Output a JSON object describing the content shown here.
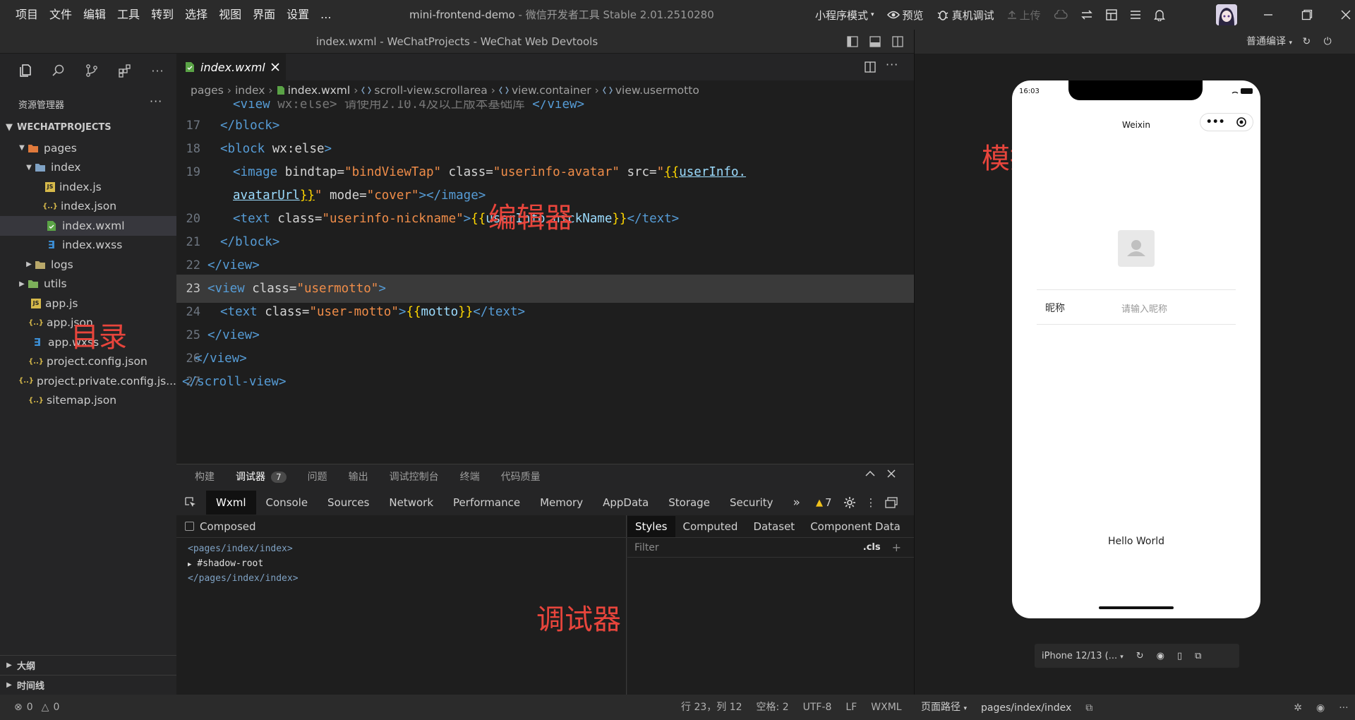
{
  "titlebar": {
    "menu": [
      "项目",
      "文件",
      "编辑",
      "工具",
      "转到",
      "选择",
      "视图",
      "界面",
      "设置",
      "..."
    ],
    "project_name": "mini-frontend-demo",
    "app_name": "微信开发者工具 Stable 2.01.2510280",
    "mode": "小程序模式",
    "preview": "预览",
    "real_debug": "真机调试",
    "upload": "上传"
  },
  "window_title": "index.wxml - WeChatProjects - WeChat Web Devtools",
  "explorer": {
    "title": "资源管理器",
    "more": "···",
    "project": "WECHATPROJECTS",
    "tree": [
      {
        "label": "pages",
        "type": "folder",
        "open": true
      },
      {
        "label": "index",
        "type": "folder",
        "open": true
      },
      {
        "label": "index.js",
        "type": "js"
      },
      {
        "label": "index.json",
        "type": "json"
      },
      {
        "label": "index.wxml",
        "type": "wxml",
        "selected": true
      },
      {
        "label": "index.wxss",
        "type": "wxss"
      },
      {
        "label": "logs",
        "type": "folder",
        "open": false
      },
      {
        "label": "utils",
        "type": "folder",
        "open": false
      },
      {
        "label": "app.js",
        "type": "js"
      },
      {
        "label": "app.json",
        "type": "json"
      },
      {
        "label": "app.wxss",
        "type": "wxss"
      },
      {
        "label": "project.config.json",
        "type": "json"
      },
      {
        "label": "project.private.config.js...",
        "type": "json"
      },
      {
        "label": "sitemap.json",
        "type": "json"
      }
    ],
    "outline": "大纲",
    "timeline": "时间线"
  },
  "editor": {
    "tab": "index.wxml",
    "breadcrumb": [
      "pages",
      "index",
      "index.wxml",
      "scroll-view.scrollarea",
      "view.container",
      "view.usermotto"
    ],
    "line_numbers": [
      "17",
      "18",
      "19",
      "",
      "20",
      "21",
      "22",
      "23",
      "24",
      "25",
      "26",
      "27"
    ],
    "current_line": "23"
  },
  "debugger": {
    "tabs": [
      "构建",
      "调试器",
      "问题",
      "输出",
      "调试控制台",
      "终端",
      "代码质量"
    ],
    "badge": "7",
    "devtools_tabs": [
      "Wxml",
      "Console",
      "Sources",
      "Network",
      "Performance",
      "Memory",
      "AppData",
      "Storage",
      "Security"
    ],
    "more": "»",
    "warnings": "7",
    "composed": "Composed",
    "dom": [
      "<pages/index/index>",
      "#shadow-root",
      "</pages/index/index>"
    ],
    "style_tabs": [
      "Styles",
      "Computed",
      "Dataset",
      "Component Data"
    ],
    "filter_placeholder": "Filter",
    "cls": ".cls",
    "plus": "+"
  },
  "annotations": {
    "explorer": "目录",
    "editor": "编辑器",
    "debugger": "调试器",
    "simulator": "模拟器"
  },
  "simulator": {
    "compile_mode": "普通编译",
    "clock": "16:03",
    "nav_title": "Weixin",
    "nickname_label": "昵称",
    "nickname_placeholder": "请输入昵称",
    "motto": "Hello World",
    "device": "iPhone 12/13 (..."
  },
  "statusbar": {
    "errors": "0",
    "warnings": "0",
    "position": "行 23，列 12",
    "spaces": "空格: 2",
    "encoding": "UTF-8",
    "eol": "LF",
    "language": "WXML",
    "page_path_label": "页面路径",
    "page_path": "pages/index/index"
  },
  "colors": {
    "annotation": "#e8453c",
    "tag": "#569cd6",
    "string": "#f08d49",
    "variable": "#9cdcfe"
  }
}
